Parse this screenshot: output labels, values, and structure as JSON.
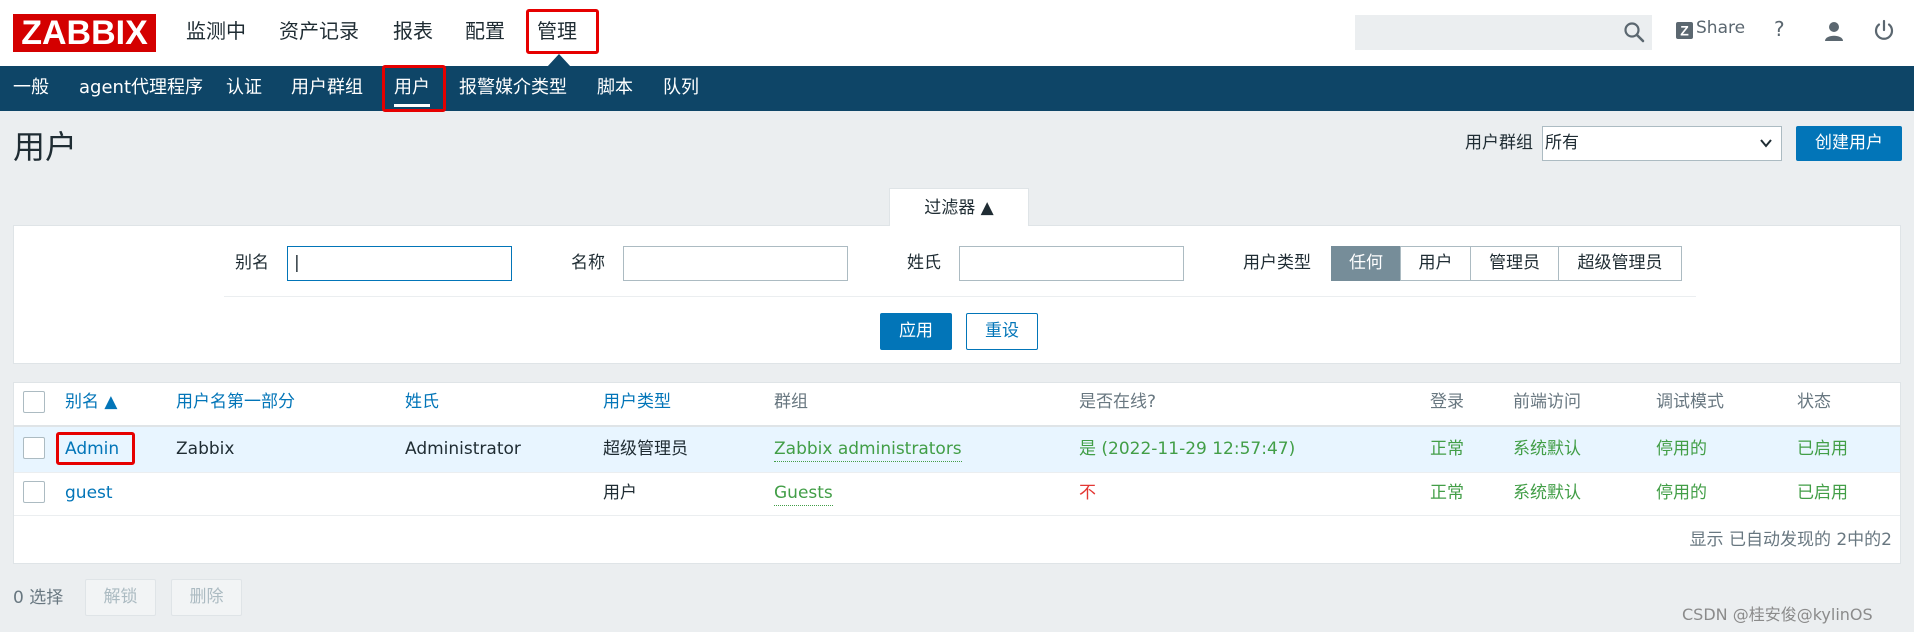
{
  "app": {
    "logo": "ZABBIX"
  },
  "main_menu": [
    "监测中",
    "资产记录",
    "报表",
    "配置",
    "管理"
  ],
  "header_actions": {
    "share_label": "Share",
    "help": "?"
  },
  "sub_menu": [
    "一般",
    "agent代理程序",
    "认证",
    "用户群组",
    "用户",
    "报警媒介类型",
    "脚本",
    "队列"
  ],
  "page": {
    "title": "用户",
    "group_filter_label": "用户群组",
    "group_filter_value": "所有",
    "create_button": "创建用户"
  },
  "filter": {
    "tab_label": "过滤器 ▲",
    "alias_label": "别名",
    "alias_value": "|",
    "name_label": "名称",
    "name_value": "",
    "surname_label": "姓氏",
    "surname_value": "",
    "type_label": "用户类型",
    "type_options": [
      "任何",
      "用户",
      "管理员",
      "超级管理员"
    ],
    "type_selected": "任何",
    "apply_button": "应用",
    "reset_button": "重设"
  },
  "table": {
    "columns": [
      "别名 ▲",
      "用户名第一部分",
      "姓氏",
      "用户类型",
      "群组",
      "是否在线?",
      "登录",
      "前端访问",
      "调试模式",
      "状态"
    ],
    "rows": [
      {
        "alias": "Admin",
        "name": "Zabbix",
        "surname": "Administrator",
        "type": "超级管理员",
        "groups": "Zabbix administrators",
        "online": "是 (2022-11-29 12:57:47)",
        "login": "正常",
        "frontend": "系统默认",
        "debug": "停用的",
        "status": "已启用"
      },
      {
        "alias": "guest",
        "name": "",
        "surname": "",
        "type": "用户",
        "groups": "Guests",
        "online": "不",
        "login": "正常",
        "frontend": "系统默认",
        "debug": "停用的",
        "status": "已启用"
      }
    ],
    "footer": "显示 已自动发现的 2中的2"
  },
  "bottom": {
    "selected_count": "0 选择",
    "unlock_button": "解锁",
    "delete_button": "删除"
  },
  "watermark": "CSDN @桂安俊@kylinOS",
  "colors": {
    "brand": "#d40000",
    "nav": "#0e4567",
    "primary": "#0275b8",
    "green": "#429e47",
    "red": "#e33734",
    "highlight_box": "#e60000"
  }
}
